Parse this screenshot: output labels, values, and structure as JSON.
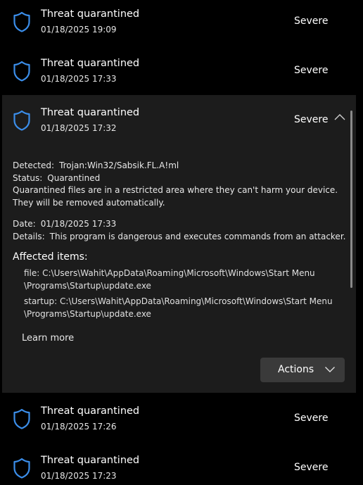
{
  "threats": [
    {
      "title": "Threat quarantined",
      "date": "01/18/2025 19:09",
      "severity": "Severe"
    },
    {
      "title": "Threat quarantined",
      "date": "01/18/2025 17:33",
      "severity": "Severe"
    },
    {
      "title": "Threat quarantined",
      "date": "01/18/2025 17:32",
      "severity": "Severe"
    },
    {
      "title": "Threat quarantined",
      "date": "01/18/2025 17:26",
      "severity": "Severe"
    },
    {
      "title": "Threat quarantined",
      "date": "01/18/2025 17:23",
      "severity": "Severe"
    }
  ],
  "details": {
    "detected_label": "Detected:",
    "detected_value": "Trojan:Win32/Sabsik.FL.A!ml",
    "status_label": "Status:",
    "status_value": "Quarantined",
    "status_note": "Quarantined files are in a restricted area where they can't harm your device. They will be removed automatically.",
    "date_label": "Date:",
    "date_value": "01/18/2025 17:33",
    "details_label": "Details:",
    "details_value": "This program is dangerous and executes commands from an attacker.",
    "affected_heading": "Affected items:",
    "affected_items": [
      {
        "label": "file:",
        "path": "C:\\Users\\Wahit\\AppData\\Roaming\\Microsoft\\Windows\\Start Menu \\Programs\\Startup\\update.exe"
      },
      {
        "label": "startup:",
        "path": "C:\\Users\\Wahit\\AppData\\Roaming\\Microsoft\\Windows\\Start Menu \\Programs\\Startup\\update.exe"
      }
    ],
    "learn_more": "Learn more",
    "actions_label": "Actions"
  },
  "icons": {
    "shield": "shield-icon",
    "expand": "chevron-up-icon",
    "actions": "chevron-down-icon"
  },
  "colors": {
    "accent": "#3b8eea",
    "background": "#000000",
    "expanded_card": "#1c1c1c",
    "button": "#3a3a3a"
  }
}
